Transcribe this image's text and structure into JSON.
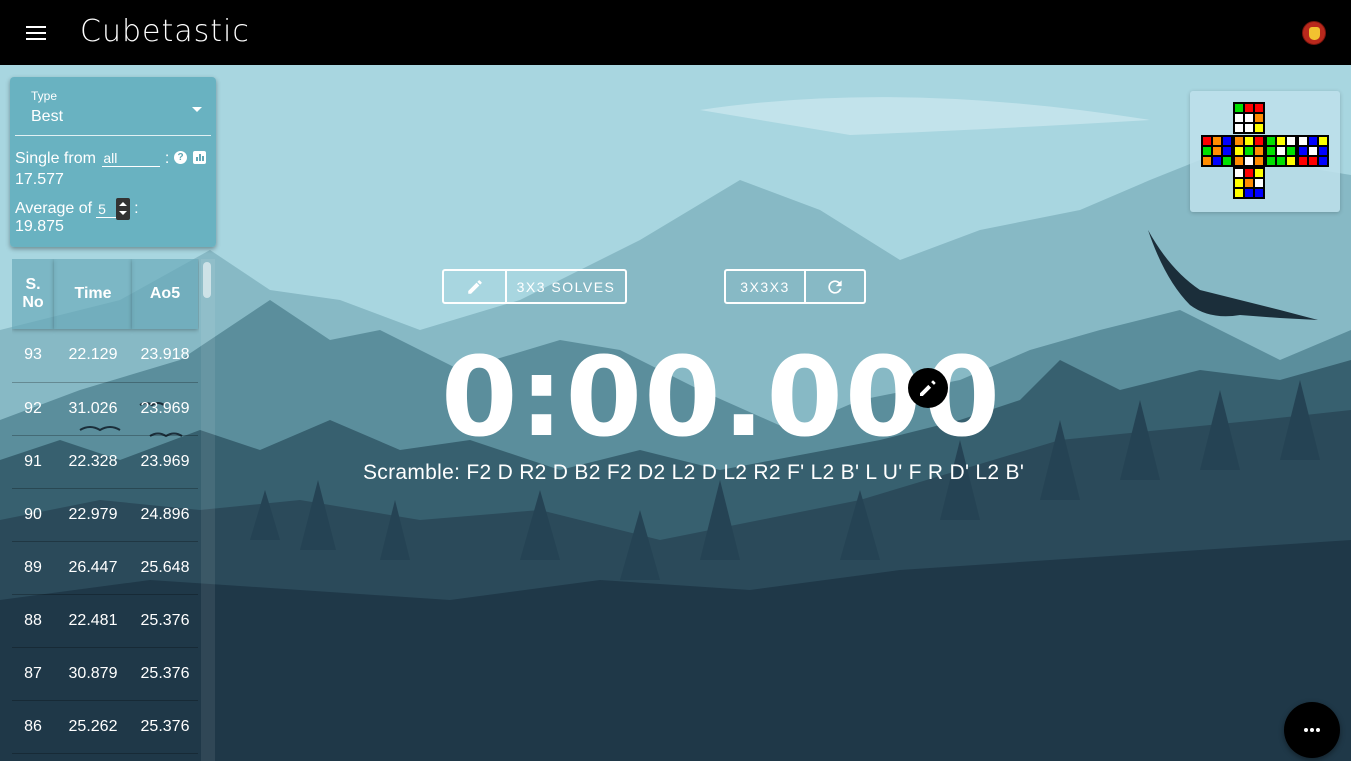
{
  "app": {
    "title": "Cubetastic",
    "menu_icon": "hamburger-menu-icon",
    "avatar_icon": "ironman-avatar-icon"
  },
  "stats": {
    "type_label": "Type",
    "type_value": "Best",
    "single_label": "Single from",
    "single_range": "all",
    "single_colon": ":",
    "single_value": "17.577",
    "average_label": "Average of",
    "average_n": "5",
    "average_colon": ":",
    "average_value": "19.875"
  },
  "table": {
    "headers": [
      "S. No",
      "Time",
      "Ao5"
    ],
    "header_sno_line1": "S.",
    "header_sno_line2": "No",
    "rows": [
      {
        "sno": "93",
        "time": "22.129",
        "ao5": "23.918"
      },
      {
        "sno": "92",
        "time": "31.026",
        "ao5": "23.969"
      },
      {
        "sno": "91",
        "time": "22.328",
        "ao5": "23.969"
      },
      {
        "sno": "90",
        "time": "22.979",
        "ao5": "24.896"
      },
      {
        "sno": "89",
        "time": "26.447",
        "ao5": "25.648"
      },
      {
        "sno": "88",
        "time": "22.481",
        "ao5": "25.376"
      },
      {
        "sno": "87",
        "time": "30.879",
        "ao5": "25.376"
      },
      {
        "sno": "86",
        "time": "25.262",
        "ao5": "25.376"
      }
    ]
  },
  "controls": {
    "session_label": "3X3 SOLVES",
    "puzzle_label": "3X3X3",
    "edit_icon": "pencil-icon",
    "refresh_icon": "refresh-icon"
  },
  "timer": {
    "display": "0:00.000"
  },
  "scramble": {
    "label": "Scramble:",
    "moves": "F2 D R2 D B2 F2 D2 L2 D L2 R2 F' L2 B' L U' F R D' L2 B'"
  },
  "colors": {
    "topbar": "#000000",
    "sky": "#a8d6e0",
    "mountain_far": "#7fb3bf",
    "mountain_mid": "#4d7f8c",
    "forest": "#2b4a5a",
    "forest_dark": "#1d3344",
    "cube_white": "#ffffff",
    "cube_green": "#00e000",
    "cube_red": "#ff0000",
    "cube_orange": "#ff8c00",
    "cube_yellow": "#ffff00",
    "cube_blue": "#0000ff"
  },
  "cube": {
    "up": [
      "G",
      "R",
      "R",
      "W",
      "W",
      "O",
      "W",
      "W",
      "Y"
    ],
    "left": [
      "R",
      "O",
      "B",
      "G",
      "O",
      "B",
      "O",
      "B",
      "G"
    ],
    "front": [
      "O",
      "Y",
      "R",
      "Y",
      "G",
      "O",
      "O",
      "W",
      "O"
    ],
    "right": [
      "G",
      "Y",
      "W",
      "G",
      "W",
      "G",
      "G",
      "G",
      "Y"
    ],
    "back": [
      "W",
      "B",
      "Y",
      "B",
      "W",
      "B",
      "R",
      "R",
      "B"
    ],
    "down": [
      "W",
      "R",
      "Y",
      "Y",
      "O",
      "W",
      "Y",
      "B",
      "B"
    ]
  },
  "fab_icon": "more-horizontal-icon"
}
